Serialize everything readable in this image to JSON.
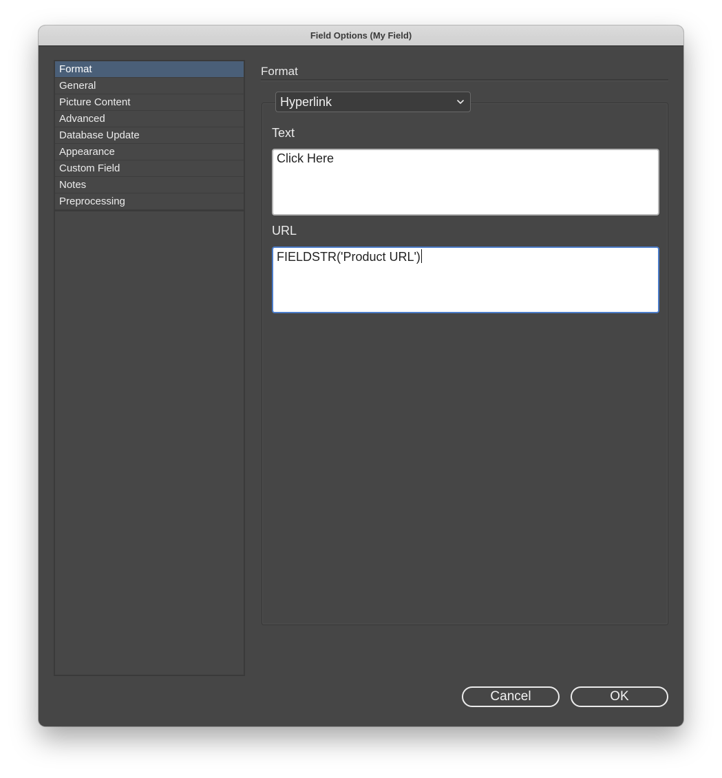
{
  "window": {
    "title": "Field Options (My Field)"
  },
  "sidebar": {
    "items": [
      {
        "label": "Format",
        "selected": true
      },
      {
        "label": "General"
      },
      {
        "label": "Picture Content"
      },
      {
        "label": "Advanced"
      },
      {
        "label": "Database Update"
      },
      {
        "label": "Appearance"
      },
      {
        "label": "Custom Field"
      },
      {
        "label": "Notes"
      },
      {
        "label": "Preprocessing"
      }
    ]
  },
  "main": {
    "section_title": "Format",
    "format_select": {
      "value": "Hyperlink",
      "icon": "chevron-down-icon"
    },
    "text_field": {
      "label": "Text",
      "value": "Click Here"
    },
    "url_field": {
      "label": "URL",
      "value": "FIELDSTR('Product URL')"
    }
  },
  "buttons": {
    "cancel_label": "Cancel",
    "ok_label": "OK"
  },
  "colors": {
    "window_bg": "#464646",
    "selection": "#4a5f78",
    "focus_ring": "#4b7cc9"
  }
}
